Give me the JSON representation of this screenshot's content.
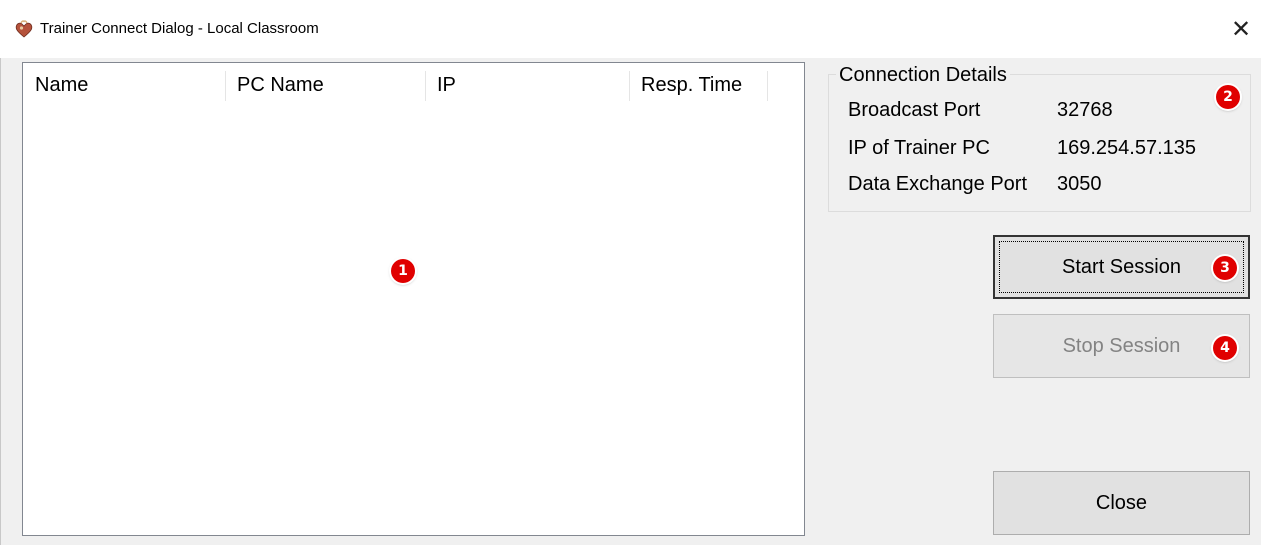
{
  "window": {
    "title": "Trainer Connect Dialog - Local Classroom",
    "close_glyph": "✕",
    "app_icon": "heart-app-icon"
  },
  "list": {
    "columns": [
      "Name",
      "PC Name",
      "IP",
      "Resp. Time"
    ],
    "rows": [],
    "badge": "1"
  },
  "connection": {
    "title": "Connection Details",
    "badge": "2",
    "items": [
      {
        "label": "Broadcast Port",
        "value": "32768"
      },
      {
        "label": "IP of Trainer PC",
        "value": "169.254.57.135"
      },
      {
        "label": "Data Exchange Port",
        "value": "3050"
      }
    ]
  },
  "buttons": {
    "start_label": "Start Session",
    "start_badge": "3",
    "stop_label": "Stop Session",
    "stop_badge": "4",
    "stop_enabled": false,
    "close_label": "Close"
  },
  "colors": {
    "badge": "#e00000",
    "button_face": "#e1e1e1",
    "disabled_text": "#838383",
    "window_bg": "#f0f0f0"
  }
}
